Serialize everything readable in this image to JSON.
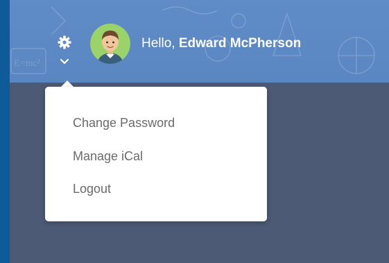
{
  "header": {
    "greeting_prefix": "Hello, ",
    "user_name": "Edward McPherson",
    "icons": {
      "settings": "gear-icon",
      "expand": "chevron-down-icon",
      "avatar": "user-avatar"
    },
    "colors": {
      "header_bg": "#5f8bc6",
      "page_bg": "#4d5a76",
      "text": "#ffffff"
    }
  },
  "dropdown": {
    "items": [
      {
        "label": "Change Password"
      },
      {
        "label": "Manage iCal"
      },
      {
        "label": "Logout"
      }
    ],
    "colors": {
      "bg": "#ffffff",
      "text": "#6b6b6b"
    }
  }
}
